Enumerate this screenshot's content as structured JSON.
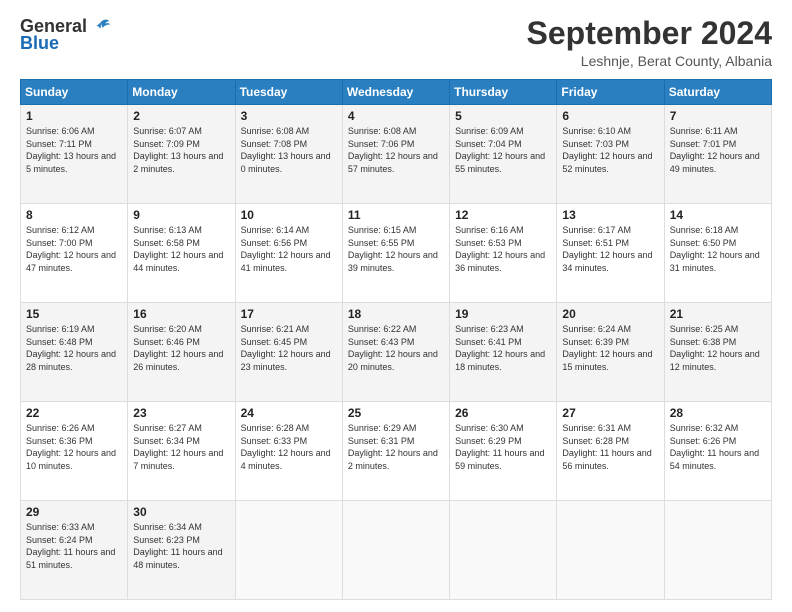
{
  "header": {
    "logo_general": "General",
    "logo_blue": "Blue",
    "title": "September 2024",
    "location": "Leshnje, Berat County, Albania"
  },
  "days_of_week": [
    "Sunday",
    "Monday",
    "Tuesday",
    "Wednesday",
    "Thursday",
    "Friday",
    "Saturday"
  ],
  "weeks": [
    [
      {
        "day": "1",
        "sunrise": "6:06 AM",
        "sunset": "7:11 PM",
        "daylight": "13 hours and 5 minutes."
      },
      {
        "day": "2",
        "sunrise": "6:07 AM",
        "sunset": "7:09 PM",
        "daylight": "13 hours and 2 minutes."
      },
      {
        "day": "3",
        "sunrise": "6:08 AM",
        "sunset": "7:08 PM",
        "daylight": "13 hours and 0 minutes."
      },
      {
        "day": "4",
        "sunrise": "6:08 AM",
        "sunset": "7:06 PM",
        "daylight": "12 hours and 57 minutes."
      },
      {
        "day": "5",
        "sunrise": "6:09 AM",
        "sunset": "7:04 PM",
        "daylight": "12 hours and 55 minutes."
      },
      {
        "day": "6",
        "sunrise": "6:10 AM",
        "sunset": "7:03 PM",
        "daylight": "12 hours and 52 minutes."
      },
      {
        "day": "7",
        "sunrise": "6:11 AM",
        "sunset": "7:01 PM",
        "daylight": "12 hours and 49 minutes."
      }
    ],
    [
      {
        "day": "8",
        "sunrise": "6:12 AM",
        "sunset": "7:00 PM",
        "daylight": "12 hours and 47 minutes."
      },
      {
        "day": "9",
        "sunrise": "6:13 AM",
        "sunset": "6:58 PM",
        "daylight": "12 hours and 44 minutes."
      },
      {
        "day": "10",
        "sunrise": "6:14 AM",
        "sunset": "6:56 PM",
        "daylight": "12 hours and 41 minutes."
      },
      {
        "day": "11",
        "sunrise": "6:15 AM",
        "sunset": "6:55 PM",
        "daylight": "12 hours and 39 minutes."
      },
      {
        "day": "12",
        "sunrise": "6:16 AM",
        "sunset": "6:53 PM",
        "daylight": "12 hours and 36 minutes."
      },
      {
        "day": "13",
        "sunrise": "6:17 AM",
        "sunset": "6:51 PM",
        "daylight": "12 hours and 34 minutes."
      },
      {
        "day": "14",
        "sunrise": "6:18 AM",
        "sunset": "6:50 PM",
        "daylight": "12 hours and 31 minutes."
      }
    ],
    [
      {
        "day": "15",
        "sunrise": "6:19 AM",
        "sunset": "6:48 PM",
        "daylight": "12 hours and 28 minutes."
      },
      {
        "day": "16",
        "sunrise": "6:20 AM",
        "sunset": "6:46 PM",
        "daylight": "12 hours and 26 minutes."
      },
      {
        "day": "17",
        "sunrise": "6:21 AM",
        "sunset": "6:45 PM",
        "daylight": "12 hours and 23 minutes."
      },
      {
        "day": "18",
        "sunrise": "6:22 AM",
        "sunset": "6:43 PM",
        "daylight": "12 hours and 20 minutes."
      },
      {
        "day": "19",
        "sunrise": "6:23 AM",
        "sunset": "6:41 PM",
        "daylight": "12 hours and 18 minutes."
      },
      {
        "day": "20",
        "sunrise": "6:24 AM",
        "sunset": "6:39 PM",
        "daylight": "12 hours and 15 minutes."
      },
      {
        "day": "21",
        "sunrise": "6:25 AM",
        "sunset": "6:38 PM",
        "daylight": "12 hours and 12 minutes."
      }
    ],
    [
      {
        "day": "22",
        "sunrise": "6:26 AM",
        "sunset": "6:36 PM",
        "daylight": "12 hours and 10 minutes."
      },
      {
        "day": "23",
        "sunrise": "6:27 AM",
        "sunset": "6:34 PM",
        "daylight": "12 hours and 7 minutes."
      },
      {
        "day": "24",
        "sunrise": "6:28 AM",
        "sunset": "6:33 PM",
        "daylight": "12 hours and 4 minutes."
      },
      {
        "day": "25",
        "sunrise": "6:29 AM",
        "sunset": "6:31 PM",
        "daylight": "12 hours and 2 minutes."
      },
      {
        "day": "26",
        "sunrise": "6:30 AM",
        "sunset": "6:29 PM",
        "daylight": "11 hours and 59 minutes."
      },
      {
        "day": "27",
        "sunrise": "6:31 AM",
        "sunset": "6:28 PM",
        "daylight": "11 hours and 56 minutes."
      },
      {
        "day": "28",
        "sunrise": "6:32 AM",
        "sunset": "6:26 PM",
        "daylight": "11 hours and 54 minutes."
      }
    ],
    [
      {
        "day": "29",
        "sunrise": "6:33 AM",
        "sunset": "6:24 PM",
        "daylight": "11 hours and 51 minutes."
      },
      {
        "day": "30",
        "sunrise": "6:34 AM",
        "sunset": "6:23 PM",
        "daylight": "11 hours and 48 minutes."
      },
      null,
      null,
      null,
      null,
      null
    ]
  ]
}
